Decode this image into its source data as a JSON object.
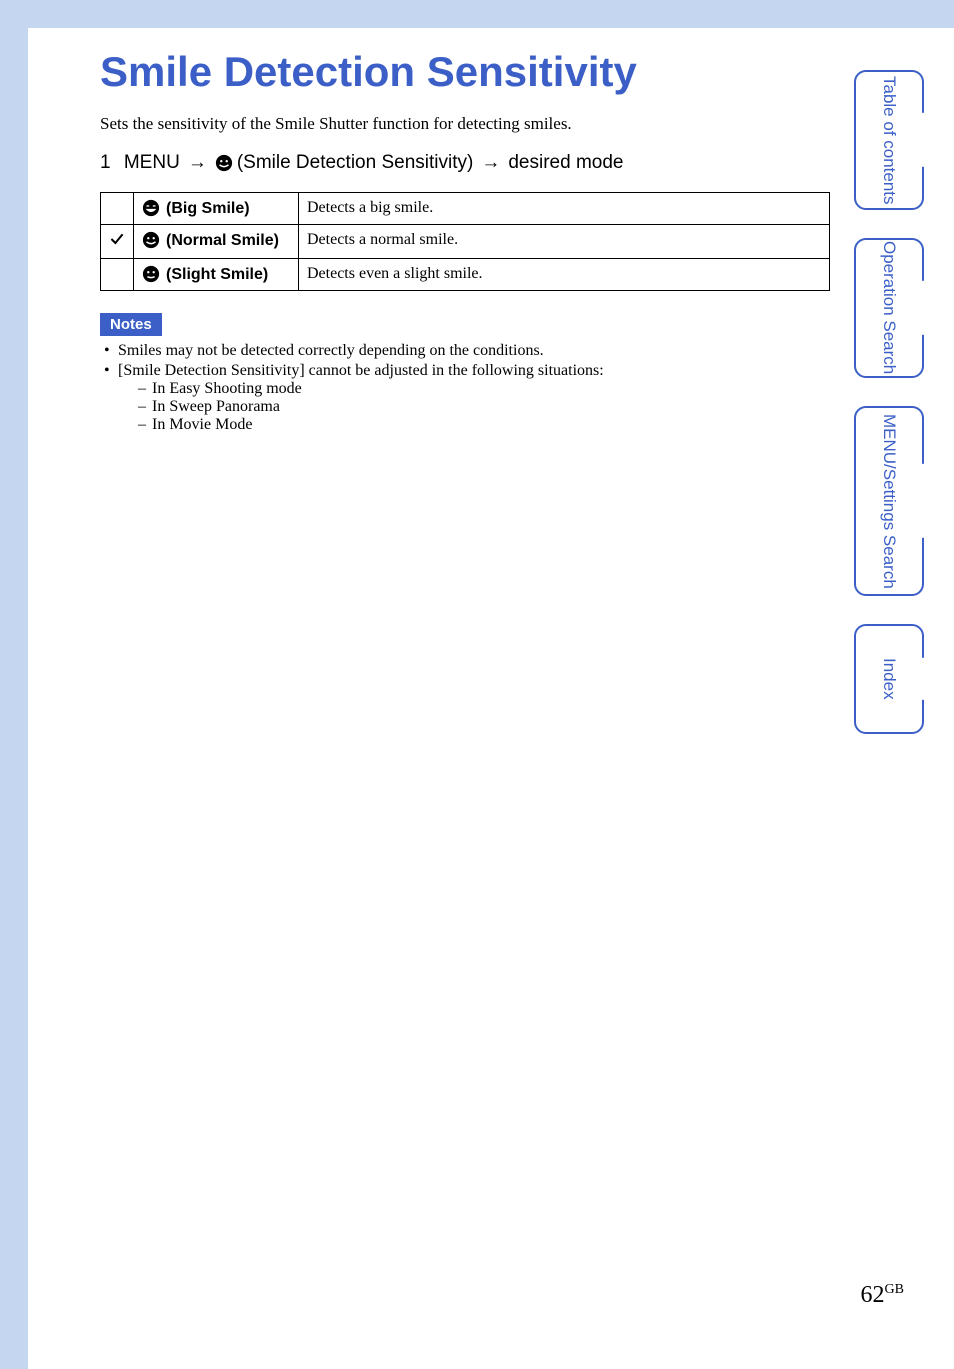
{
  "title": "Smile Detection Sensitivity",
  "intro": "Sets the sensitivity of the Smile Shutter function for detecting smiles.",
  "step": {
    "num": "1",
    "menu": "MENU",
    "mid": "(Smile Detection Sensitivity)",
    "end": "desired mode"
  },
  "table": {
    "rows": [
      {
        "checked": false,
        "smile_variant": "big",
        "label": "(Big Smile)",
        "desc": "Detects a big smile."
      },
      {
        "checked": true,
        "smile_variant": "normal",
        "label": "(Normal Smile)",
        "desc": "Detects a normal smile."
      },
      {
        "checked": false,
        "smile_variant": "slight",
        "label": "(Slight Smile)",
        "desc": "Detects even a slight smile."
      }
    ]
  },
  "notes_label": "Notes",
  "notes": [
    "Smiles may not be detected correctly depending on the conditions.",
    "[Smile Detection Sensitivity] cannot be adjusted in the following situations:"
  ],
  "notes_sub": [
    "In Easy Shooting mode",
    "In Sweep Panorama",
    "In Movie Mode"
  ],
  "tabs": {
    "t1": "Table of contents",
    "t2": "Operation Search",
    "t3": "MENU/Settings Search",
    "t4": "Index"
  },
  "page": {
    "num": "62",
    "suffix": "GB"
  }
}
